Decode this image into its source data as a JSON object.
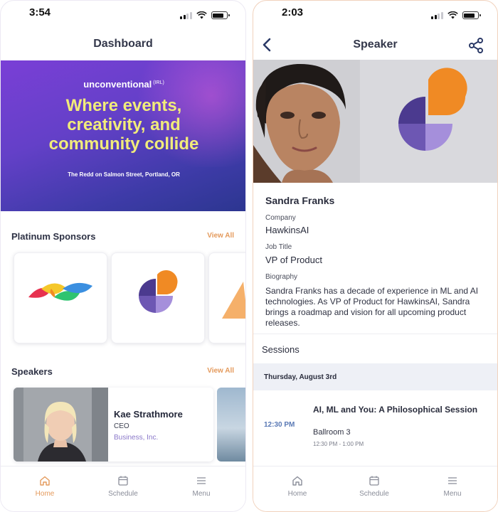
{
  "left_screen": {
    "status_time": "3:54",
    "title": "Dashboard",
    "hero": {
      "brand": "unconventional",
      "brand_tag": "(IRL)",
      "headline_lines": [
        "Where events,",
        "creativity, and",
        "community collide"
      ],
      "location": "The Redd on Salmon Street, Portland, OR"
    },
    "sponsors": {
      "title": "Platinum Sponsors",
      "view_all": "View All",
      "logos": [
        "rainbow-leaves-logo",
        "quadrant-circle-logo",
        "orange-wedge-logo"
      ]
    },
    "speakers": {
      "title": "Speakers",
      "view_all": "View All",
      "cards": [
        {
          "name": "Kae Strathmore",
          "role": "CEO",
          "company": "Business, Inc."
        }
      ]
    },
    "tab_bar": {
      "tabs": [
        {
          "label": "Home",
          "icon": "home-icon",
          "active": true
        },
        {
          "label": "Schedule",
          "icon": "calendar-icon",
          "active": false
        },
        {
          "label": "Menu",
          "icon": "hamburger-icon",
          "active": false
        }
      ]
    }
  },
  "right_screen": {
    "status_time": "2:03",
    "title": "Speaker",
    "speaker": {
      "name": "Sandra Franks",
      "company_label": "Company",
      "company": "HawkinsAI",
      "job_title_label": "Job Title",
      "job_title": "VP of Product",
      "biography_label": "Biography",
      "biography": "Sandra Franks has a decade of experience in ML and AI technologies. As VP of Product for HawkinsAI, Sandra brings a roadmap and vision for all upcoming product releases."
    },
    "sessions": {
      "title": "Sessions",
      "date": "Thursday, August 3rd",
      "items": [
        {
          "time": "12:30 PM",
          "title": "AI, ML and You: A Philosophical Session",
          "room": "Ballroom 3",
          "range": "12:30 PM - 1:00 PM"
        }
      ]
    },
    "tab_bar": {
      "tabs": [
        {
          "label": "Home",
          "icon": "home-icon",
          "active": false
        },
        {
          "label": "Schedule",
          "icon": "calendar-icon",
          "active": false
        },
        {
          "label": "Menu",
          "icon": "hamburger-icon",
          "active": false
        }
      ]
    }
  },
  "colors": {
    "accent_orange": "#e49a5c",
    "headline_yellow": "#f1ec7a",
    "hero_purple": "#6440c8",
    "logo_purple_dark": "#4b3a8f",
    "logo_purple_mid": "#6d57b3",
    "logo_purple_light": "#a58fdb",
    "logo_orange": "#f08a24"
  }
}
